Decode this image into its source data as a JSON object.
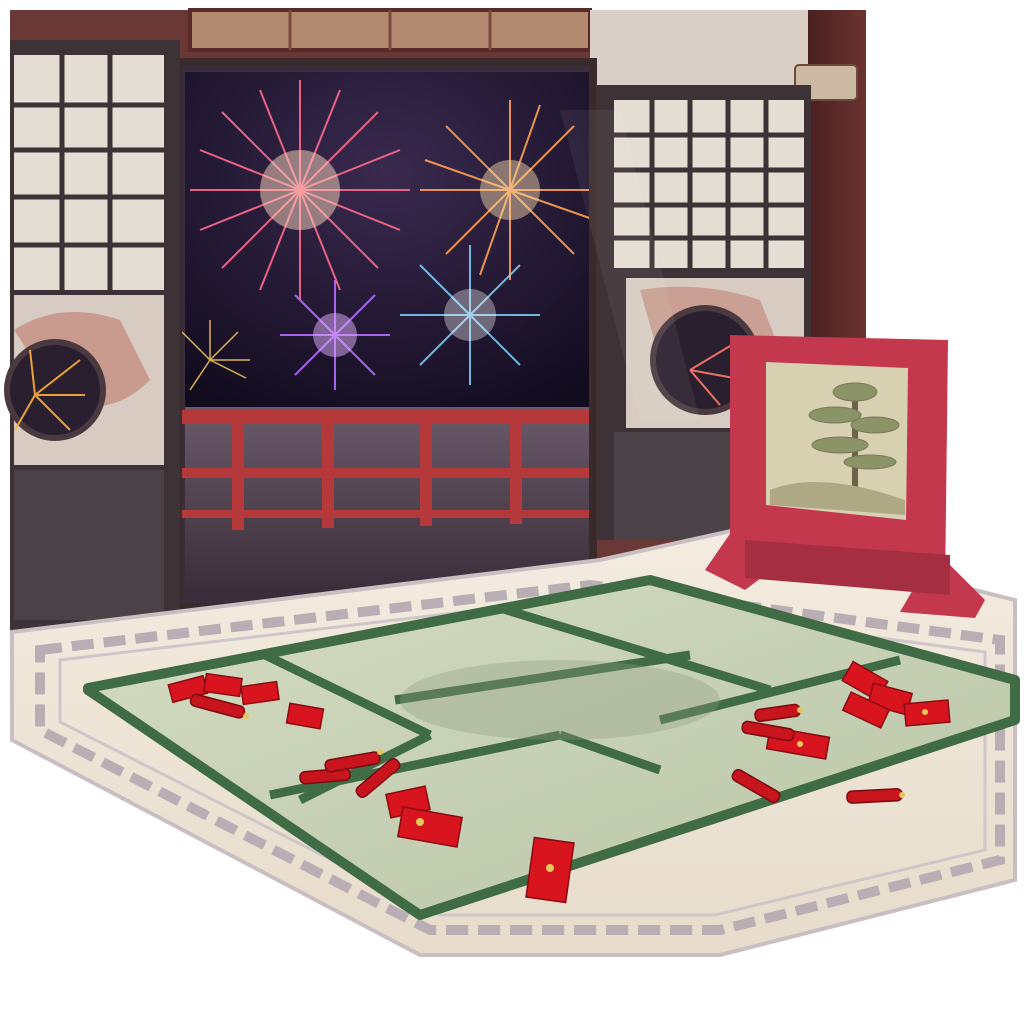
{
  "scene": {
    "description_label": "",
    "colors": {
      "background": "#ffffff",
      "wall_wood": "#5a2a2a",
      "wall_wood_light": "#7a3b38",
      "paper_panel": "#d9d2c7",
      "night_sky": "#1d1530",
      "railing_red": "#b5383a",
      "floor_cream": "#efe6d6",
      "floor_border": "#b9aeb3",
      "tatami": "#c8d0b6",
      "tatami_edge": "#3f6b45",
      "screen_frame": "#c4384e",
      "screen_panel": "#d7d1b2",
      "red_envelope": "#d8141e",
      "gold": "#e8c65a"
    },
    "objects": [
      {
        "name": "back-wall",
        "kind": "architecture"
      },
      {
        "name": "fireworks-window",
        "kind": "window"
      },
      {
        "name": "left-lattice-window",
        "kind": "window"
      },
      {
        "name": "right-lattice-window",
        "kind": "window"
      },
      {
        "name": "balcony-railing",
        "kind": "railing"
      },
      {
        "name": "folding-screen",
        "kind": "furniture"
      },
      {
        "name": "floor-rug",
        "kind": "floor"
      },
      {
        "name": "tatami-mats",
        "kind": "floor"
      },
      {
        "name": "red-envelopes",
        "kind": "decoration",
        "count": 12
      },
      {
        "name": "firecrackers",
        "kind": "decoration",
        "count": 8
      }
    ]
  }
}
